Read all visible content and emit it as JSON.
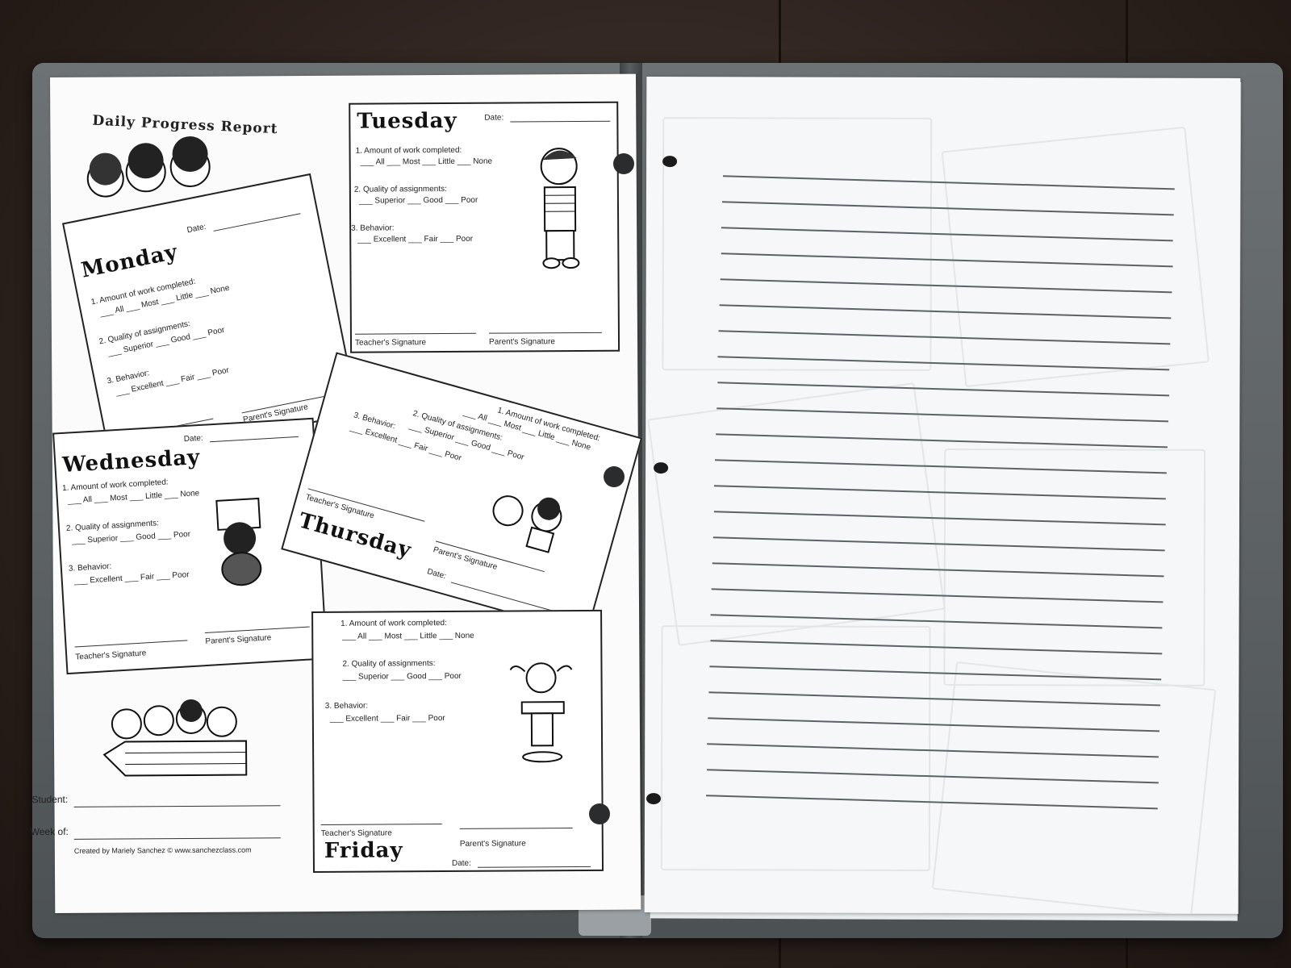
{
  "report_title": "Daily Progress Report",
  "labels": {
    "date": "Date:",
    "amount": "1. Amount of work completed:",
    "amount_opts": "___ All  ___ Most  ___ Little  ___ None",
    "quality": "2. Quality of assignments:",
    "quality_opts": "___ Superior  ___ Good  ___ Poor",
    "behavior": "3. Behavior:",
    "behavior_opts": "___ Excellent  ___ Fair  ___ Poor",
    "teacher_sig": "Teacher's Signature",
    "parent_sig": "Parent's Signature"
  },
  "days": {
    "monday": "Monday",
    "tuesday": "Tuesday",
    "wednesday": "Wednesday",
    "thursday": "Thursday",
    "friday": "Friday"
  },
  "student_label": "Student:",
  "week_label": "Week of:",
  "credit": "Created by Mariely Sanchez © www.sanchezclass.com"
}
